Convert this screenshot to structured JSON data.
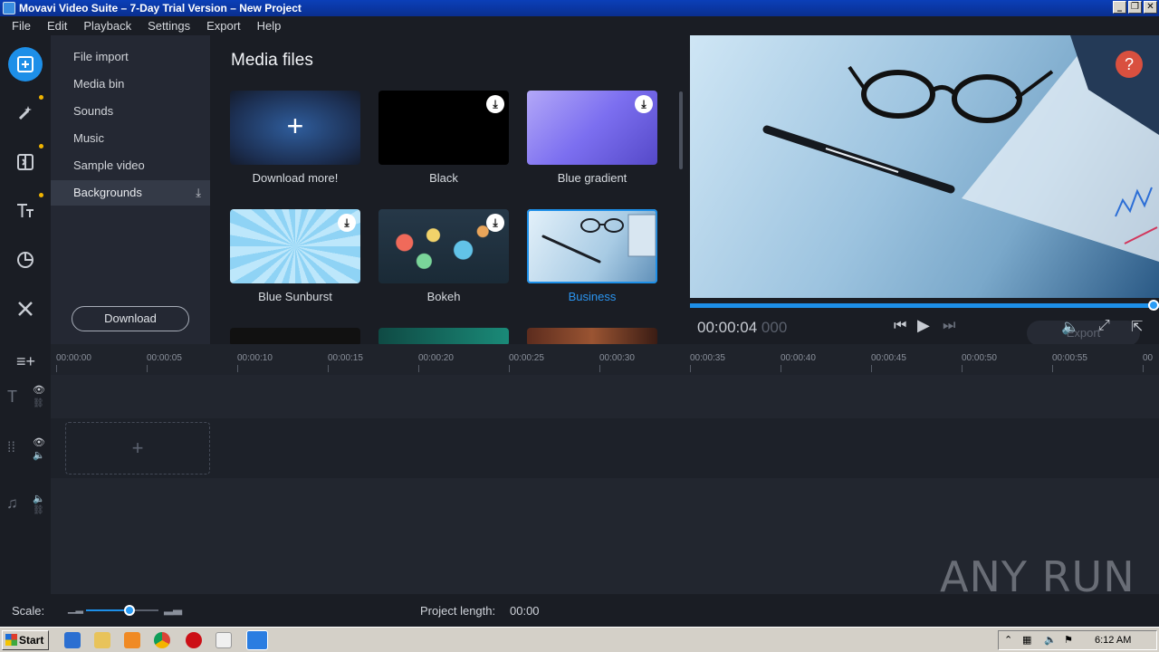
{
  "window": {
    "title": "Movavi Video Suite – 7-Day Trial Version – New Project",
    "minimize_icon": "minimize-icon",
    "restore_icon": "restore-icon",
    "close_icon": "close-icon"
  },
  "menu": [
    "File",
    "Edit",
    "Playback",
    "Settings",
    "Export",
    "Help"
  ],
  "categories": {
    "items": [
      "File import",
      "Media bin",
      "Sounds",
      "Music",
      "Sample video",
      "Backgrounds"
    ],
    "selected": "Backgrounds",
    "download_button": "Download"
  },
  "media": {
    "title": "Media files",
    "tiles": [
      {
        "label": "Download more!",
        "glyph": "+"
      },
      {
        "label": "Black"
      },
      {
        "label": "Blue gradient"
      },
      {
        "label": "Blue Sunburst"
      },
      {
        "label": "Bokeh"
      },
      {
        "label": "Business"
      }
    ],
    "selected": "Business"
  },
  "preview": {
    "help": "?",
    "timecode": "00:00:04",
    "timecode_ms": "000",
    "progress": 1.0,
    "export_label": "Export"
  },
  "ruler": [
    "00:00:00",
    "00:00:05",
    "00:00:10",
    "00:00:15",
    "00:00:20",
    "00:00:25",
    "00:00:30",
    "00:00:35",
    "00:00:40",
    "00:00:45",
    "00:00:50",
    "00:00:55",
    "00"
  ],
  "timeline": {
    "dropzone_glyph": "+"
  },
  "scale": {
    "label": "Scale:",
    "project_length_label": "Project length:",
    "project_length": "00:00"
  },
  "taskbar": {
    "start": "Start",
    "clock": "6:12 AM"
  },
  "watermark": "ANY RUN",
  "colors": {
    "accent": "#1d8fe8",
    "panel": "#242833",
    "background": "#1a1d24",
    "help": "#d9503f",
    "badge": "#f0b400"
  }
}
